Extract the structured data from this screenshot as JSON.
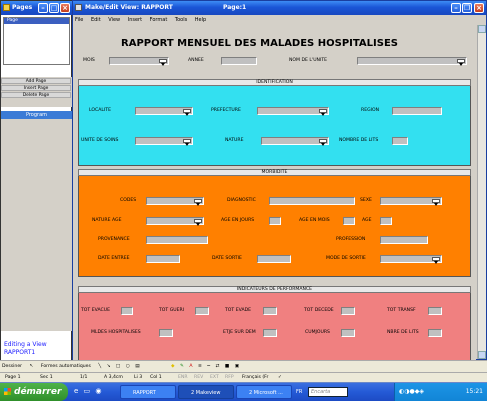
{
  "left_window": {
    "title": "Pages",
    "page_item": "Page",
    "buttons": [
      "Add Page",
      "Insert Page",
      "Delete Page"
    ],
    "program_label": "Program",
    "footer_line1": "Editing a View",
    "footer_line2": "RAPPORT1"
  },
  "main_window": {
    "title": "Make/Edit View: RAPPORT",
    "page_indicator": "Page:1",
    "menu": [
      "File",
      "Edit",
      "View",
      "Insert",
      "Format",
      "Tools",
      "Help"
    ]
  },
  "form": {
    "title": "RAPPORT MENSUEL DES MALADES HOSPITALISES",
    "mois": "MOIS",
    "annee": "ANNEE",
    "nom_unite": "NOM DE L'UNITE",
    "identification": {
      "title": "IDENTIFICATION",
      "localite": "LOCALITE",
      "prefecture": "PREFECTURE",
      "region": "REGION",
      "unite_soins": "UNITE DE SOINS",
      "nature": "NATURE",
      "nombre_lits": "NOMBRE DE LITS"
    },
    "morbidite": {
      "title": "MORBIDITE",
      "codes": "CODES",
      "diagnostic": "DIAGNOSTIC",
      "sexe": "SEXE",
      "nature_age": "NATURE AGE",
      "age_jours": "AGE EN JOURS",
      "age_mois": "AGE EN MOIS",
      "age": "AGE",
      "provenance": "PROVENANCE",
      "profession": "PROFESSION",
      "date_entree": "DATE ENTREE",
      "date_sortie": "DATE SORTIE",
      "mode_sortie": "MODE DE SORTIE"
    },
    "performance": {
      "title": "INDICATEURS DE PERFORMANCE",
      "tot_evacue": "TOT EVACUE",
      "tot_gueri": "TOT GUERI",
      "tot_evade": "TOT EVADE",
      "tot_decede": "TOT DECEDE",
      "tot_transf": "TOT TRANSF",
      "malades_hosp": "MLDES HOSPITALISES",
      "etje_sur_dem": "ETJE SUR DEM",
      "cum_jours": "CUMJOURS",
      "nbre_lits": "NBRE DE LITS"
    }
  },
  "drawing_toolbar": {
    "dessiner": "Dessiner",
    "formes": "Formes automatiques"
  },
  "statusbar": [
    "Page 1",
    "Sec 1",
    "1/1",
    "A 3,4cm",
    "Li 3",
    "Col 1",
    "ENR",
    "REV",
    "EXT",
    "RFP",
    "Français (Fr"
  ],
  "taskbar": {
    "start": "démarrer",
    "items": [
      "RAPPORT",
      "2 Makeview",
      "2 Microsoft ...",
      "FR"
    ],
    "search_placeholder": "Encarta",
    "clock": "15:21"
  },
  "colors": {
    "identification_bg": "#33e0f0",
    "morbidite_bg": "#ff8000",
    "performance_bg": "#f08080"
  }
}
